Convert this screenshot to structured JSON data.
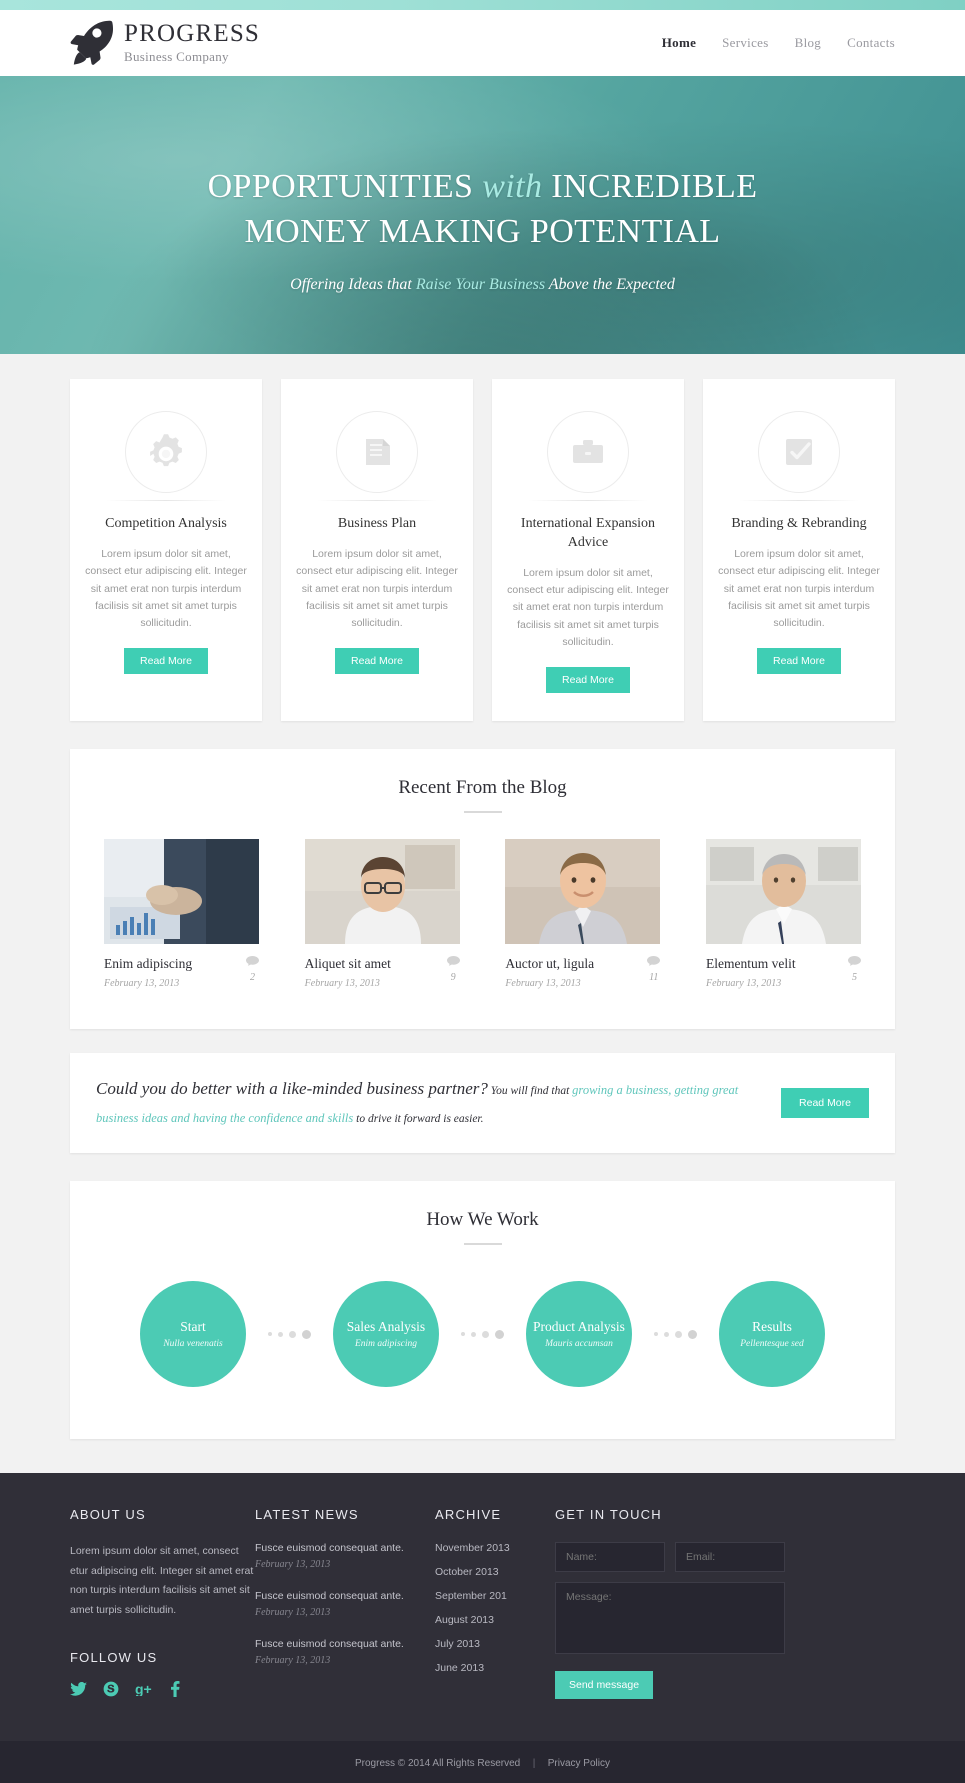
{
  "colors": {
    "accent": "#3fceb4",
    "accent_light": "#a9ebe3",
    "hero": "#55a5a0",
    "footer": "#302f38"
  },
  "header": {
    "brand_name": "PROGRESS",
    "brand_sub": "Business Company",
    "logo_icon": "rocket-icon",
    "nav": [
      {
        "label": "Home",
        "active": true
      },
      {
        "label": "Services",
        "active": false
      },
      {
        "label": "Blog",
        "active": false
      },
      {
        "label": "Contacts",
        "active": false
      }
    ]
  },
  "hero": {
    "title_part1": "OPPORTUNITIES ",
    "title_em": "with",
    "title_part2": " INCREDIBLE",
    "title_line2": "MONEY MAKING POTENTIAL",
    "sub_part1": "Offering Ideas that ",
    "sub_em": "Raise Your Business",
    "sub_part2": " Above the Expected"
  },
  "services": {
    "read_more_label": "Read More",
    "cards": [
      {
        "icon": "gears-icon",
        "title": "Competition Analysis",
        "desc": "Lorem ipsum dolor sit amet, consect etur adipiscing elit. Integer sit amet erat non turpis interdum facilisis sit amet sit amet turpis sollicitudin."
      },
      {
        "icon": "book-icon",
        "title": "Business Plan",
        "desc": "Lorem ipsum dolor sit amet, consect etur adipiscing elit. Integer sit amet erat non turpis interdum facilisis sit amet sit amet turpis sollicitudin."
      },
      {
        "icon": "briefcase-icon",
        "title": "International Expansion Advice",
        "desc": "Lorem ipsum dolor sit amet, consect etur adipiscing elit. Integer sit amet erat non turpis interdum facilisis sit amet sit amet turpis sollicitudin."
      },
      {
        "icon": "check-square-icon",
        "title": "Branding & Rebranding",
        "desc": "Lorem ipsum dolor sit amet, consect etur adipiscing elit. Integer sit amet erat non turpis interdum facilisis sit amet sit amet turpis sollicitudin."
      }
    ]
  },
  "blog": {
    "title": "Recent From the Blog",
    "posts": [
      {
        "title": "Enim adipiscing",
        "date": "February 13, 2013",
        "comments": "2",
        "image": "handshake-photo"
      },
      {
        "title": "Aliquet sit amet",
        "date": "February 13, 2013",
        "comments": "9",
        "image": "woman-glasses-photo"
      },
      {
        "title": "Auctor ut, ligula",
        "date": "February 13, 2013",
        "comments": "11",
        "image": "smiling-man-photo"
      },
      {
        "title": "Elementum velit",
        "date": "February 13, 2013",
        "comments": "5",
        "image": "senior-man-photo"
      }
    ]
  },
  "quote": {
    "lead": "Could you do better with a like-minded business partner?",
    "small1": " You will find that ",
    "accent": "growing a business, getting great business ideas and having the confidence and skills",
    "small2": " to drive it forward is easier.",
    "button": "Read More"
  },
  "how_we_work": {
    "title": "How We Work",
    "steps": [
      {
        "label": "Start",
        "sub": "Nulla venenatis"
      },
      {
        "label": "Sales Analysis",
        "sub": "Enim adipiscing"
      },
      {
        "label": "Product Analysis",
        "sub": "Mauris accumsan"
      },
      {
        "label": "Results",
        "sub": "Pellentesque sed"
      }
    ]
  },
  "footer": {
    "about": {
      "head": "ABOUT US",
      "body": "Lorem ipsum dolor sit amet, consect etur adipiscing elit. Integer sit amet erat non turpis interdum facilisis sit amet sit amet turpis sollicitudin."
    },
    "follow": {
      "head": "FOLLOW US",
      "socials": [
        {
          "icon": "twitter-icon",
          "glyph": "ᵗ"
        },
        {
          "icon": "skype-icon",
          "glyph": "S"
        },
        {
          "icon": "google-plus-icon",
          "glyph": "g+"
        },
        {
          "icon": "facebook-icon",
          "glyph": "f"
        }
      ]
    },
    "news": {
      "head": "LATEST NEWS",
      "items": [
        {
          "title": "Fusce euismod consequat ante.",
          "date": "February 13, 2013"
        },
        {
          "title": "Fusce euismod consequat ante.",
          "date": "February 13, 2013"
        },
        {
          "title": "Fusce euismod consequat ante.",
          "date": "February 13, 2013"
        }
      ]
    },
    "archive": {
      "head": "ARCHIVE",
      "items": [
        "November 2013",
        "October 2013",
        "September 201",
        "August 2013",
        "July 2013",
        "June 2013"
      ]
    },
    "contact": {
      "head": "GET IN TOUCH",
      "name_placeholder": "Name:",
      "email_placeholder": "Email:",
      "message_placeholder": "Message:",
      "send_label": "Send message"
    },
    "copyright": "Progress © 2014 All Rights Reserved",
    "privacy": "Privacy Policy",
    "separator": "|"
  }
}
